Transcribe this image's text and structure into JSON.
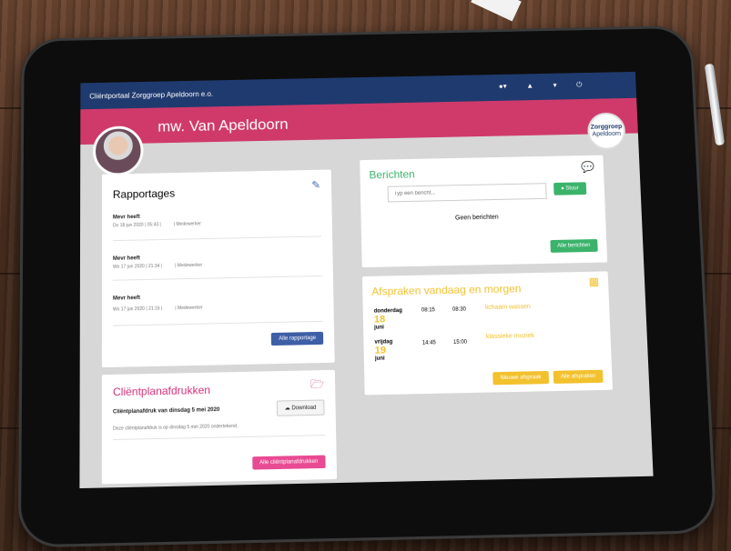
{
  "app": {
    "title": "Cliëntportaal Zorggroep Apeldoorn e.o.",
    "icons": [
      "info-icon",
      "bell-icon",
      "user-icon",
      "power-icon"
    ],
    "logo_line1": "Zorggroep",
    "logo_line2": "Apeldoorn"
  },
  "profile": {
    "name": "mw. Van Apeldoorn"
  },
  "rapportages": {
    "title": "Rapportages",
    "items": [
      {
        "title": "Mevr heeft",
        "date": "Do 18 jun 2020 | 05:43 |",
        "author": "| Medewerker"
      },
      {
        "title": "Mevr heeft",
        "date": "Wo 17 jun 2020 | 21:34 |",
        "author": "| Medewerker"
      },
      {
        "title": "Mevr heeft",
        "date": "Wo 17 jun 2020 | 21:16 |",
        "author": "| Medewerker"
      }
    ],
    "button": "Alle rapportage"
  },
  "clientplan": {
    "title": "Cliëntplanafdrukken",
    "item_title": "Cliëntplanafdruk van dinsdag 5 mei 2020",
    "item_note": "Deze cliëntplanafdruk is op dinsdag 5 mei 2020 ondertekend.",
    "download": "Download",
    "button": "Alle cliëntplanafdrukken"
  },
  "berichten": {
    "title": "Berichten",
    "placeholder": "Typ een bericht...",
    "send": "Stuur",
    "empty": "Geen berichten",
    "button": "Alle berichten"
  },
  "afspraken": {
    "title": "Afspraken vandaag en morgen",
    "items": [
      {
        "day": "donderdag",
        "num": "18",
        "month": "juni",
        "start": "08:15",
        "end": "08:30",
        "label": "lichaam wassen"
      },
      {
        "day": "vrijdag",
        "num": "19",
        "month": "juni",
        "start": "14:45",
        "end": "15:00",
        "label": "klassieke muziek"
      }
    ],
    "btn_new": "Nieuwe afspraak",
    "btn_all": "Alle afspraken"
  },
  "colors": {
    "navy": "#1f3a6e",
    "pink": "#cf3a6b",
    "green": "#3bb36b",
    "yellow": "#f2c12e",
    "blue_btn": "#3e5fa6",
    "pink_btn": "#e84b93"
  }
}
